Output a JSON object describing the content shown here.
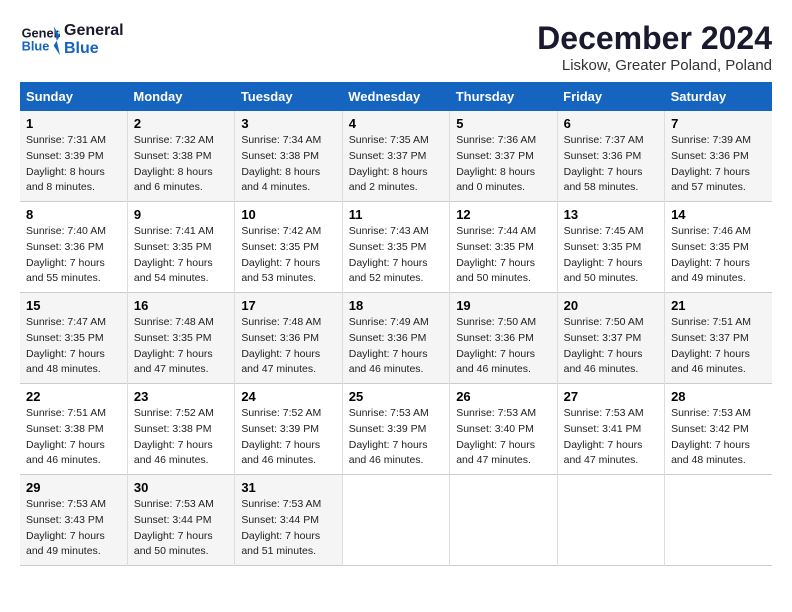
{
  "logo": {
    "line1": "General",
    "line2": "Blue"
  },
  "title": "December 2024",
  "subtitle": "Liskow, Greater Poland, Poland",
  "days_of_week": [
    "Sunday",
    "Monday",
    "Tuesday",
    "Wednesday",
    "Thursday",
    "Friday",
    "Saturday"
  ],
  "weeks": [
    [
      {
        "day": "1",
        "sunrise": "Sunrise: 7:31 AM",
        "sunset": "Sunset: 3:39 PM",
        "daylight": "Daylight: 8 hours and 8 minutes."
      },
      {
        "day": "2",
        "sunrise": "Sunrise: 7:32 AM",
        "sunset": "Sunset: 3:38 PM",
        "daylight": "Daylight: 8 hours and 6 minutes."
      },
      {
        "day": "3",
        "sunrise": "Sunrise: 7:34 AM",
        "sunset": "Sunset: 3:38 PM",
        "daylight": "Daylight: 8 hours and 4 minutes."
      },
      {
        "day": "4",
        "sunrise": "Sunrise: 7:35 AM",
        "sunset": "Sunset: 3:37 PM",
        "daylight": "Daylight: 8 hours and 2 minutes."
      },
      {
        "day": "5",
        "sunrise": "Sunrise: 7:36 AM",
        "sunset": "Sunset: 3:37 PM",
        "daylight": "Daylight: 8 hours and 0 minutes."
      },
      {
        "day": "6",
        "sunrise": "Sunrise: 7:37 AM",
        "sunset": "Sunset: 3:36 PM",
        "daylight": "Daylight: 7 hours and 58 minutes."
      },
      {
        "day": "7",
        "sunrise": "Sunrise: 7:39 AM",
        "sunset": "Sunset: 3:36 PM",
        "daylight": "Daylight: 7 hours and 57 minutes."
      }
    ],
    [
      {
        "day": "8",
        "sunrise": "Sunrise: 7:40 AM",
        "sunset": "Sunset: 3:36 PM",
        "daylight": "Daylight: 7 hours and 55 minutes."
      },
      {
        "day": "9",
        "sunrise": "Sunrise: 7:41 AM",
        "sunset": "Sunset: 3:35 PM",
        "daylight": "Daylight: 7 hours and 54 minutes."
      },
      {
        "day": "10",
        "sunrise": "Sunrise: 7:42 AM",
        "sunset": "Sunset: 3:35 PM",
        "daylight": "Daylight: 7 hours and 53 minutes."
      },
      {
        "day": "11",
        "sunrise": "Sunrise: 7:43 AM",
        "sunset": "Sunset: 3:35 PM",
        "daylight": "Daylight: 7 hours and 52 minutes."
      },
      {
        "day": "12",
        "sunrise": "Sunrise: 7:44 AM",
        "sunset": "Sunset: 3:35 PM",
        "daylight": "Daylight: 7 hours and 50 minutes."
      },
      {
        "day": "13",
        "sunrise": "Sunrise: 7:45 AM",
        "sunset": "Sunset: 3:35 PM",
        "daylight": "Daylight: 7 hours and 50 minutes."
      },
      {
        "day": "14",
        "sunrise": "Sunrise: 7:46 AM",
        "sunset": "Sunset: 3:35 PM",
        "daylight": "Daylight: 7 hours and 49 minutes."
      }
    ],
    [
      {
        "day": "15",
        "sunrise": "Sunrise: 7:47 AM",
        "sunset": "Sunset: 3:35 PM",
        "daylight": "Daylight: 7 hours and 48 minutes."
      },
      {
        "day": "16",
        "sunrise": "Sunrise: 7:48 AM",
        "sunset": "Sunset: 3:35 PM",
        "daylight": "Daylight: 7 hours and 47 minutes."
      },
      {
        "day": "17",
        "sunrise": "Sunrise: 7:48 AM",
        "sunset": "Sunset: 3:36 PM",
        "daylight": "Daylight: 7 hours and 47 minutes."
      },
      {
        "day": "18",
        "sunrise": "Sunrise: 7:49 AM",
        "sunset": "Sunset: 3:36 PM",
        "daylight": "Daylight: 7 hours and 46 minutes."
      },
      {
        "day": "19",
        "sunrise": "Sunrise: 7:50 AM",
        "sunset": "Sunset: 3:36 PM",
        "daylight": "Daylight: 7 hours and 46 minutes."
      },
      {
        "day": "20",
        "sunrise": "Sunrise: 7:50 AM",
        "sunset": "Sunset: 3:37 PM",
        "daylight": "Daylight: 7 hours and 46 minutes."
      },
      {
        "day": "21",
        "sunrise": "Sunrise: 7:51 AM",
        "sunset": "Sunset: 3:37 PM",
        "daylight": "Daylight: 7 hours and 46 minutes."
      }
    ],
    [
      {
        "day": "22",
        "sunrise": "Sunrise: 7:51 AM",
        "sunset": "Sunset: 3:38 PM",
        "daylight": "Daylight: 7 hours and 46 minutes."
      },
      {
        "day": "23",
        "sunrise": "Sunrise: 7:52 AM",
        "sunset": "Sunset: 3:38 PM",
        "daylight": "Daylight: 7 hours and 46 minutes."
      },
      {
        "day": "24",
        "sunrise": "Sunrise: 7:52 AM",
        "sunset": "Sunset: 3:39 PM",
        "daylight": "Daylight: 7 hours and 46 minutes."
      },
      {
        "day": "25",
        "sunrise": "Sunrise: 7:53 AM",
        "sunset": "Sunset: 3:39 PM",
        "daylight": "Daylight: 7 hours and 46 minutes."
      },
      {
        "day": "26",
        "sunrise": "Sunrise: 7:53 AM",
        "sunset": "Sunset: 3:40 PM",
        "daylight": "Daylight: 7 hours and 47 minutes."
      },
      {
        "day": "27",
        "sunrise": "Sunrise: 7:53 AM",
        "sunset": "Sunset: 3:41 PM",
        "daylight": "Daylight: 7 hours and 47 minutes."
      },
      {
        "day": "28",
        "sunrise": "Sunrise: 7:53 AM",
        "sunset": "Sunset: 3:42 PM",
        "daylight": "Daylight: 7 hours and 48 minutes."
      }
    ],
    [
      {
        "day": "29",
        "sunrise": "Sunrise: 7:53 AM",
        "sunset": "Sunset: 3:43 PM",
        "daylight": "Daylight: 7 hours and 49 minutes."
      },
      {
        "day": "30",
        "sunrise": "Sunrise: 7:53 AM",
        "sunset": "Sunset: 3:44 PM",
        "daylight": "Daylight: 7 hours and 50 minutes."
      },
      {
        "day": "31",
        "sunrise": "Sunrise: 7:53 AM",
        "sunset": "Sunset: 3:44 PM",
        "daylight": "Daylight: 7 hours and 51 minutes."
      },
      null,
      null,
      null,
      null
    ]
  ]
}
